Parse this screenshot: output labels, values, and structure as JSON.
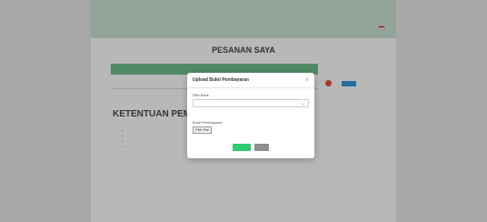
{
  "header": {
    "contact": "",
    "brand": "",
    "nav_items": [
      "",
      "",
      "",
      "",
      "",
      ""
    ],
    "flag_icon": "id-flag-icon"
  },
  "main": {
    "title": "PESANAN SAYA",
    "table": {
      "columns": [
        "",
        "",
        "",
        "",
        "",
        "",
        "",
        ""
      ],
      "row": [
        "",
        "",
        "",
        "",
        ""
      ]
    },
    "terms_heading": "KETENTUAN PEM",
    "terms_items": [
      "",
      "",
      "",
      ""
    ],
    "terms_side": ""
  },
  "modal": {
    "title": "Upload Bukti Pembayaran",
    "bank_label": "Pilih Bank",
    "bank_value": "",
    "file_label": "Bukti Pembayaran",
    "file_button": "Pilih File",
    "file_status": "",
    "submit_label": "",
    "cancel_label": ""
  },
  "colors": {
    "brand_green": "#7fbf9a",
    "table_header": "#6fbf8b",
    "status_red": "#e74c3c",
    "action_blue": "#3498db",
    "submit_green": "#2ecc71"
  }
}
